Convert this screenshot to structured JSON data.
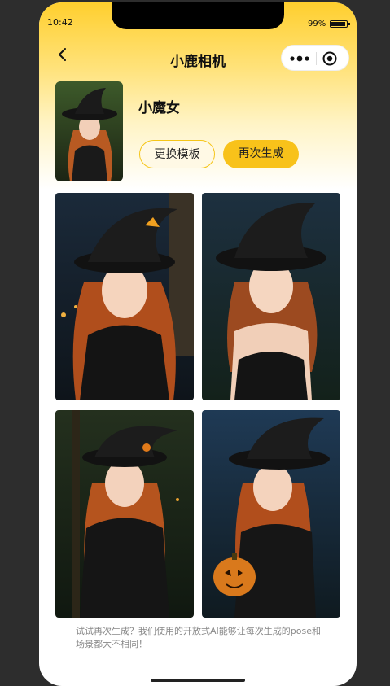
{
  "status_bar": {
    "time": "10:42",
    "battery": "99%"
  },
  "nav": {
    "title": "小鹿相机",
    "back_icon": "chevron-left-icon",
    "more_icon": "more-dots-icon",
    "close_icon": "target-circle-icon"
  },
  "template": {
    "name": "小魔女"
  },
  "actions": {
    "change_template": "更换模板",
    "regenerate": "再次生成"
  },
  "results": [
    {
      "id": "photo-1"
    },
    {
      "id": "photo-2"
    },
    {
      "id": "photo-3"
    },
    {
      "id": "photo-4"
    }
  ],
  "footer": {
    "tip": "试试再次生成？我们使用的开放式AI能够让每次生成的pose和场景都大不相同！"
  },
  "colors": {
    "accent": "#f8c21a",
    "header_top": "#ffcf2e",
    "background": "#2d2d2d"
  }
}
